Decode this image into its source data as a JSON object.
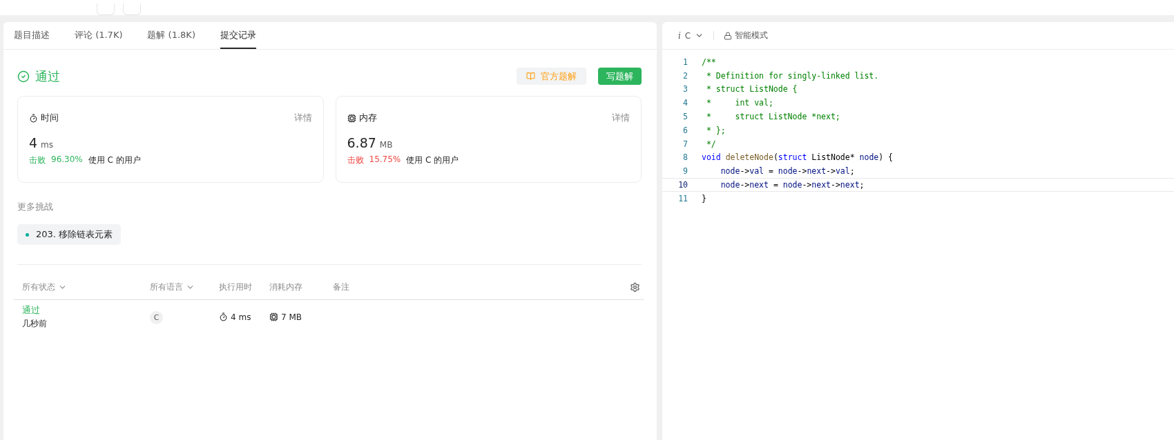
{
  "tabs": [
    {
      "label": "题目描述",
      "selected": false
    },
    {
      "label": "评论 (1.7K)",
      "selected": false
    },
    {
      "label": "题解 (1.8K)",
      "selected": false
    },
    {
      "label": "提交记录",
      "selected": true
    }
  ],
  "result": {
    "status": "通过",
    "official_button": "官方题解",
    "write_button": "写题解"
  },
  "cards": [
    {
      "kind": "time",
      "title": "时间",
      "details": "详情",
      "value": "4",
      "unit": "ms",
      "beat_label": "击败",
      "beat_percent": "96.30%",
      "color": "#2db55d",
      "suffix": "使用 C 的用户"
    },
    {
      "kind": "memory",
      "title": "内存",
      "details": "详情",
      "value": "6.87",
      "unit": "MB",
      "beat_label": "击败",
      "beat_percent": "15.75%",
      "color": "#ef4743",
      "suffix": "使用 C 的用户"
    }
  ],
  "more": {
    "title": "更多挑战",
    "items": [
      {
        "label": "203. 移除链表元素",
        "color": "#00af9b"
      }
    ]
  },
  "table": {
    "columns": [
      {
        "label": "所有状态",
        "dropdown": true
      },
      {
        "label": "所有语言",
        "dropdown": true
      },
      {
        "label": "执行用时",
        "dropdown": false
      },
      {
        "label": "消耗内存",
        "dropdown": false
      },
      {
        "label": "备注",
        "dropdown": false
      }
    ],
    "rows": [
      {
        "status": "通过",
        "time_ago": "几秒前",
        "language": "C",
        "runtime": "4 ms",
        "memory": "7 MB"
      }
    ]
  },
  "editor": {
    "language_icon": "i",
    "language": "C",
    "mode": "智能模式",
    "lines": [
      {
        "number": "1",
        "current": false,
        "tokens": [
          {
            "kind": "comment",
            "text": "/**"
          }
        ]
      },
      {
        "number": "2",
        "current": false,
        "tokens": [
          {
            "kind": "comment",
            "text": " * Definition for singly-linked list."
          }
        ]
      },
      {
        "number": "3",
        "current": false,
        "tokens": [
          {
            "kind": "comment",
            "text": " * struct ListNode {"
          }
        ]
      },
      {
        "number": "4",
        "current": false,
        "tokens": [
          {
            "kind": "comment",
            "text": " *     int val;"
          }
        ]
      },
      {
        "number": "5",
        "current": false,
        "tokens": [
          {
            "kind": "comment",
            "text": " *     struct ListNode *next;"
          }
        ]
      },
      {
        "number": "6",
        "current": false,
        "tokens": [
          {
            "kind": "comment",
            "text": " * };"
          }
        ]
      },
      {
        "number": "7",
        "current": false,
        "tokens": [
          {
            "kind": "comment",
            "text": " */"
          }
        ]
      },
      {
        "number": "8",
        "current": false,
        "tokens": [
          {
            "kind": "keyword",
            "text": "void"
          },
          {
            "kind": "function",
            "text": " deleteNode"
          },
          {
            "kind": "plain",
            "text": "("
          },
          {
            "kind": "keyword",
            "text": "struct"
          },
          {
            "kind": "plain",
            "text": " ListNode* "
          },
          {
            "kind": "variable",
            "text": "node"
          },
          {
            "kind": "plain",
            "text": ") {"
          }
        ]
      },
      {
        "number": "9",
        "current": false,
        "tokens": [
          {
            "kind": "variable",
            "text": "    node"
          },
          {
            "kind": "plain",
            "text": "->"
          },
          {
            "kind": "variable",
            "text": "val"
          },
          {
            "kind": "plain",
            "text": " = "
          },
          {
            "kind": "variable",
            "text": "node"
          },
          {
            "kind": "plain",
            "text": "->"
          },
          {
            "kind": "variable",
            "text": "next"
          },
          {
            "kind": "plain",
            "text": "->"
          },
          {
            "kind": "variable",
            "text": "val"
          },
          {
            "kind": "plain",
            "text": ";"
          }
        ]
      },
      {
        "number": "10",
        "current": true,
        "tokens": [
          {
            "kind": "variable",
            "text": "    node"
          },
          {
            "kind": "plain",
            "text": "->"
          },
          {
            "kind": "variable",
            "text": "next"
          },
          {
            "kind": "plain",
            "text": " = "
          },
          {
            "kind": "variable",
            "text": "node"
          },
          {
            "kind": "plain",
            "text": "->"
          },
          {
            "kind": "variable",
            "text": "next"
          },
          {
            "kind": "plain",
            "text": "->"
          },
          {
            "kind": "variable",
            "text": "next"
          },
          {
            "kind": "plain",
            "text": ";"
          }
        ]
      },
      {
        "number": "11",
        "current": false,
        "tokens": [
          {
            "kind": "plain",
            "text": "}"
          }
        ]
      }
    ]
  }
}
